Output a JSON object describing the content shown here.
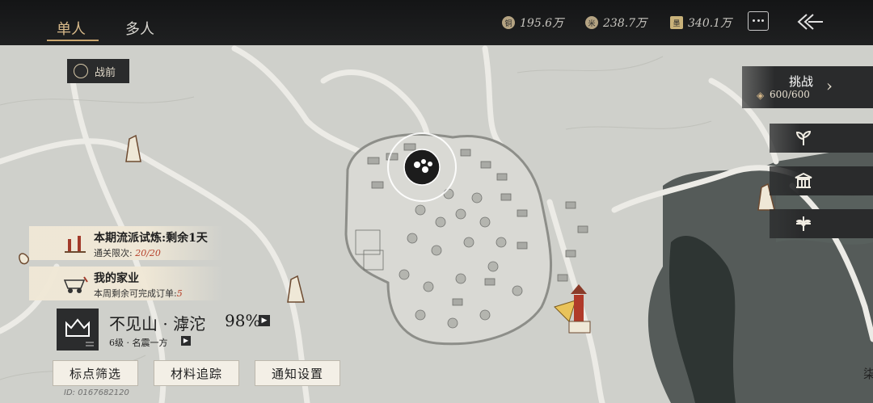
{
  "tabs": [
    {
      "label": "单人",
      "active": true
    },
    {
      "label": "多人",
      "active": false
    }
  ],
  "currencies": [
    {
      "icon": "copper-coin-icon",
      "glyph": "铜",
      "value": "195.6万"
    },
    {
      "icon": "grain-coin-icon",
      "glyph": "米",
      "value": "238.7万"
    },
    {
      "icon": "ink-icon",
      "glyph": "墨",
      "value": "340.1万"
    }
  ],
  "era_button": {
    "label": "战前"
  },
  "challenge": {
    "title": "挑战",
    "count": "600/600"
  },
  "side_buttons": [
    {
      "icon": "plant-sprout-icon"
    },
    {
      "icon": "building-icon"
    },
    {
      "icon": "flower-emblem-icon"
    }
  ],
  "notices": [
    {
      "title": "本期流派试炼:剩余1天",
      "sub_label": "通关限次:",
      "sub_value": "20/20"
    },
    {
      "title": "我的家业",
      "sub_label": "本周剩余可完成订单:",
      "sub_value": "5"
    }
  ],
  "location": {
    "name": "不见山 · 滹沱",
    "percent": "98%",
    "subtitle": "6级 · 名震一方"
  },
  "bottom_buttons": [
    "标点筛选",
    "材料追踪",
    "通知设置"
  ],
  "uid": "ID: 0167682120",
  "edge_text": "柒",
  "colors": {
    "accent": "#d7b98a",
    "panel": "#2a2b2c",
    "map": "#cfd0cb",
    "river": "#3e4644"
  }
}
